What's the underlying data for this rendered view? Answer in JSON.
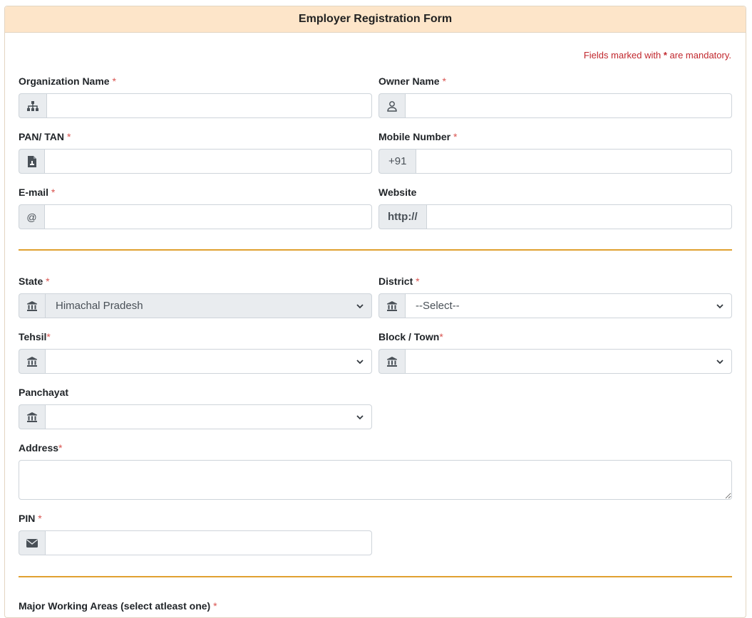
{
  "form": {
    "title": "Employer Registration Form",
    "note_prefix": "Fields marked with",
    "note_star": "*",
    "note_suffix": "are mandatory."
  },
  "fields": {
    "organization_name": {
      "label": "Organization Name",
      "req": "*",
      "icon": "sitemap-icon",
      "value": ""
    },
    "owner_name": {
      "label": "Owner Name",
      "req": "*",
      "icon": "user-icon",
      "value": ""
    },
    "pan_tan": {
      "label": "PAN/ TAN",
      "req": "*",
      "icon": "file-icon",
      "value": ""
    },
    "mobile_number": {
      "label": "Mobile Number",
      "req": "*",
      "prefix": "+91",
      "value": ""
    },
    "email": {
      "label": "E-mail",
      "req": "*",
      "prefix": "@",
      "value": ""
    },
    "website": {
      "label": "Website",
      "req": "",
      "prefix": "http://",
      "value": ""
    },
    "state": {
      "label": "State",
      "req": "*",
      "icon": "bank-icon",
      "selected": "Himachal Pradesh"
    },
    "district": {
      "label": "District",
      "req": "*",
      "icon": "bank-icon",
      "selected": "--Select--"
    },
    "tehsil": {
      "label": "Tehsil",
      "req": "*",
      "icon": "bank-icon",
      "selected": ""
    },
    "block_town": {
      "label": "Block / Town",
      "req": "*",
      "icon": "bank-icon",
      "selected": ""
    },
    "panchayat": {
      "label": "Panchayat",
      "req": "",
      "icon": "bank-icon",
      "selected": ""
    },
    "address": {
      "label": "Address",
      "req": "*",
      "value": ""
    },
    "pin": {
      "label": "PIN",
      "req": "*",
      "icon": "envelope-icon",
      "value": ""
    }
  },
  "sections": {
    "major_working_areas": {
      "label": "Major Working Areas (select atleast one)",
      "req": "*"
    }
  },
  "colors": {
    "header_bg": "#fde5c9",
    "divider": "#e0a030",
    "required": "#d9534f",
    "note": "#c1272d"
  }
}
